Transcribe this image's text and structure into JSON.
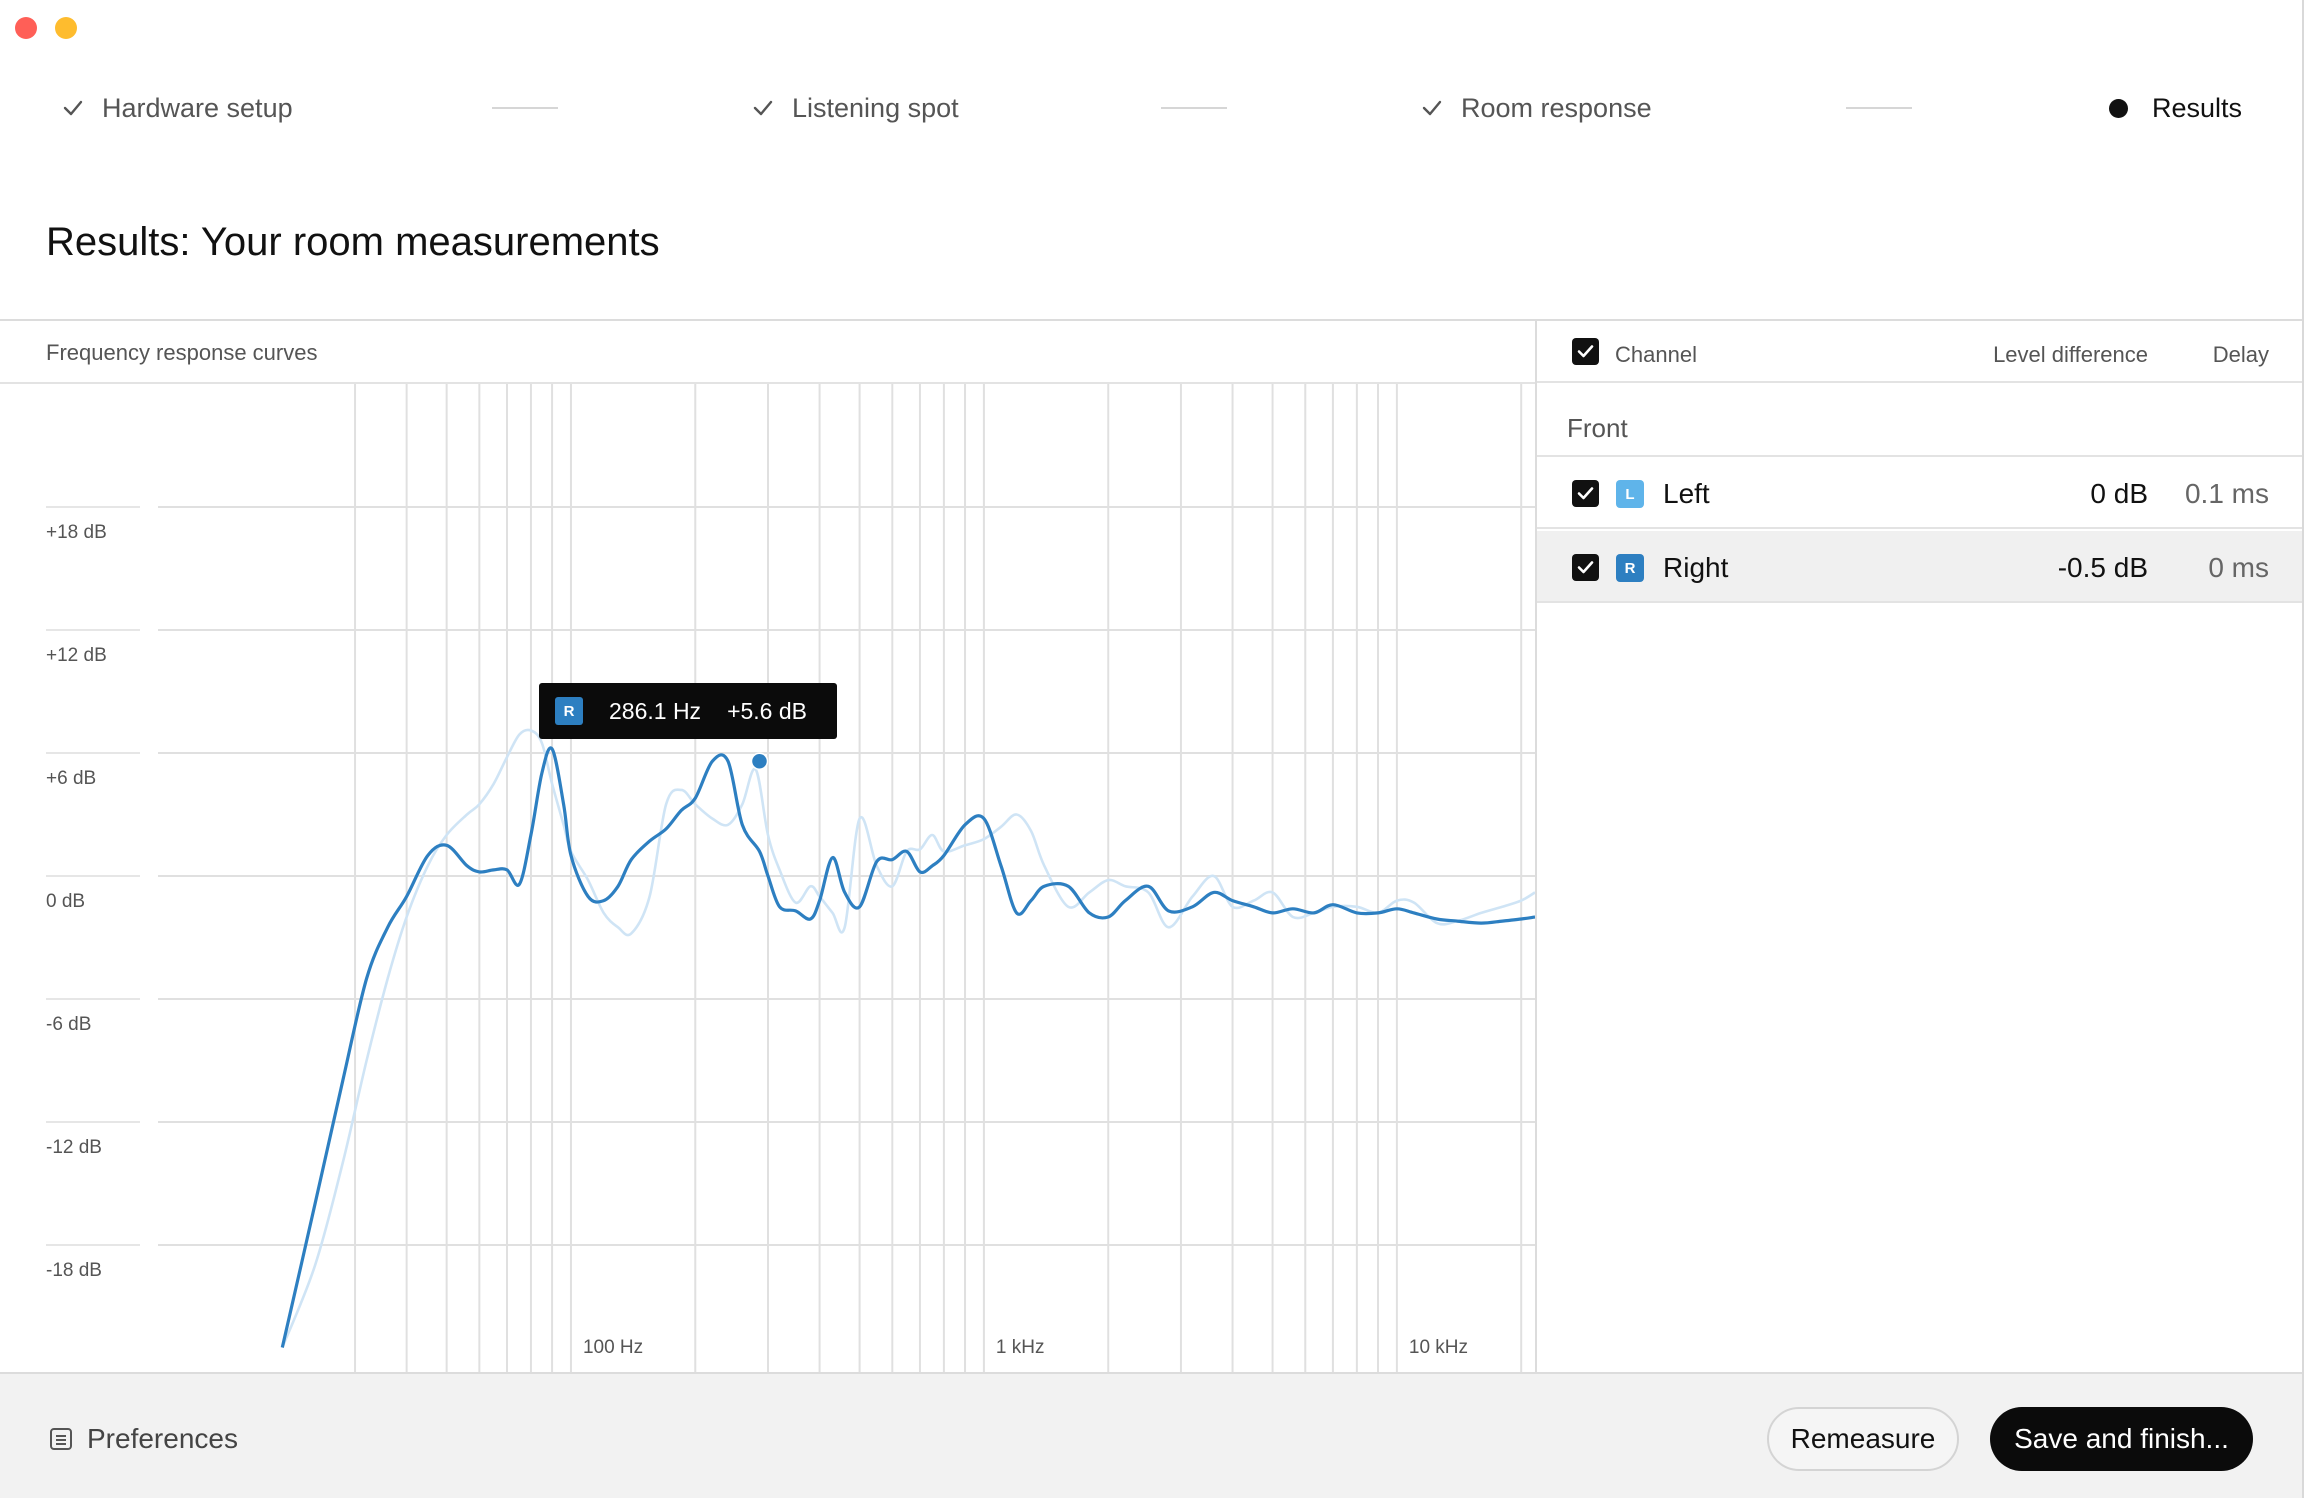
{
  "window": {
    "traffic_lights": [
      "close",
      "minimize"
    ]
  },
  "stepper": {
    "steps": [
      {
        "label": "Hardware setup",
        "state": "done",
        "icon": "check-icon"
      },
      {
        "label": "Listening spot",
        "state": "done",
        "icon": "check-icon"
      },
      {
        "label": "Room response",
        "state": "done",
        "icon": "check-icon"
      },
      {
        "label": "Results",
        "state": "current",
        "icon": "dot-icon"
      }
    ]
  },
  "page": {
    "title": "Results: Your room measurements"
  },
  "chart_panel": {
    "label": "Frequency response curves"
  },
  "tooltip": {
    "channel_badge": "R",
    "frequency": "286.1 Hz",
    "level": "+5.6 dB"
  },
  "table": {
    "header": {
      "channel": "Channel",
      "level_difference": "Level difference",
      "delay": "Delay"
    },
    "group": "Front",
    "rows": [
      {
        "badge": "L",
        "name": "Left",
        "level": "0 dB",
        "delay": "0.1 ms",
        "checked": true,
        "color": "#5fb4ea"
      },
      {
        "badge": "R",
        "name": "Right",
        "level": "-0.5 dB",
        "delay": "0 ms",
        "checked": true,
        "color": "#2d7fc1",
        "selected": true
      }
    ]
  },
  "footer": {
    "preferences_label": "Preferences",
    "remeasure_label": "Remeasure",
    "save_label": "Save and finish..."
  },
  "chart_data": {
    "type": "line",
    "title": "Frequency response curves",
    "xlabel": "",
    "ylabel": "",
    "x_scale": "log",
    "xlim": [
      10,
      21600
    ],
    "ylim": [
      -23,
      21
    ],
    "x_ticks": [
      {
        "value": 100,
        "label": "100 Hz"
      },
      {
        "value": 1000,
        "label": "1 kHz"
      },
      {
        "value": 10000,
        "label": "10 kHz"
      }
    ],
    "y_ticks": [
      {
        "value": 18,
        "label": "+18 dB"
      },
      {
        "value": 12,
        "label": "+12 dB"
      },
      {
        "value": 6,
        "label": "+6 dB"
      },
      {
        "value": 0,
        "label": "0 dB"
      },
      {
        "value": -6,
        "label": "-6 dB"
      },
      {
        "value": -12,
        "label": "-12 dB"
      },
      {
        "value": -18,
        "label": "-18 dB"
      }
    ],
    "grid": true,
    "highlight_point": {
      "series": "Right",
      "x": 286.1,
      "y": 5.6
    },
    "series": [
      {
        "name": "Left",
        "color": "#cfe4f5",
        "x": [
          20,
          24,
          28,
          32,
          36,
          40,
          45,
          50,
          56,
          60,
          65,
          70,
          75,
          80,
          85,
          90,
          96,
          100,
          110,
          120,
          130,
          140,
          155,
          170,
          185,
          200,
          220,
          240,
          260,
          280,
          300,
          320,
          350,
          380,
          400,
          430,
          460,
          500,
          550,
          600,
          650,
          700,
          750,
          800,
          900,
          1000,
          1100,
          1200,
          1300,
          1400,
          1600,
          1800,
          2000,
          2200,
          2500,
          2800,
          3200,
          3600,
          4000,
          4500,
          5000,
          5600,
          6300,
          7000,
          8000,
          9000,
          10000,
          11000,
          12500,
          14000,
          16000,
          18000,
          20000,
          21600
        ],
        "y": [
          -23,
          -19,
          -14,
          -9,
          -5,
          -2,
          0.5,
          2,
          3,
          3.5,
          4.5,
          5.8,
          6.9,
          7.1,
          6.5,
          4.5,
          2.5,
          1.2,
          -0.2,
          -1.8,
          -2.5,
          -2.8,
          -1,
          3.5,
          4.2,
          3.5,
          2.8,
          2.5,
          3.5,
          5.2,
          2,
          0.3,
          -1.3,
          -0.5,
          -1,
          -1.8,
          -2.5,
          2.8,
          0.5,
          -0.5,
          1.2,
          1.3,
          2,
          1.2,
          1.5,
          1.8,
          2.4,
          3,
          2.2,
          0.5,
          -1.5,
          -0.8,
          -0.2,
          -0.5,
          -0.8,
          -2.5,
          -1,
          0,
          -1.5,
          -1.2,
          -0.8,
          -2,
          -1.8,
          -1.5,
          -1.5,
          -1.8,
          -1.2,
          -1.3,
          -2.3,
          -2.2,
          -1.8,
          -1.5,
          -1.2,
          -0.8
        ]
      },
      {
        "name": "Right",
        "color": "#2d7fc1",
        "x": [
          20,
          24,
          28,
          32,
          36,
          40,
          45,
          50,
          56,
          60,
          65,
          70,
          75,
          80,
          85,
          90,
          96,
          100,
          110,
          120,
          130,
          140,
          155,
          170,
          185,
          200,
          220,
          240,
          260,
          286.1,
          300,
          320,
          350,
          380,
          400,
          430,
          460,
          500,
          550,
          600,
          650,
          700,
          750,
          800,
          900,
          1000,
          1100,
          1200,
          1300,
          1400,
          1600,
          1800,
          2000,
          2200,
          2500,
          2800,
          3200,
          3600,
          4000,
          4500,
          5000,
          5600,
          6300,
          7000,
          8000,
          9000,
          10000,
          11000,
          12500,
          14000,
          16000,
          18000,
          20000,
          21600
        ],
        "y": [
          -23,
          -16,
          -10,
          -5,
          -2.5,
          -1,
          1,
          1.5,
          0.5,
          0.2,
          0.3,
          0.3,
          -0.4,
          2,
          5,
          6.2,
          3.5,
          1,
          -1,
          -1.2,
          -0.5,
          0.8,
          1.7,
          2.3,
          3.2,
          3.8,
          5.6,
          5.6,
          2.5,
          1.2,
          0,
          -1.5,
          -1.7,
          -2.1,
          -1.2,
          0.9,
          -0.8,
          -1.5,
          0.7,
          0.8,
          1.2,
          0.2,
          0.5,
          1,
          2.5,
          2.8,
          0.5,
          -1.8,
          -1.2,
          -0.5,
          -0.5,
          -1.8,
          -2,
          -1.2,
          -0.5,
          -1.7,
          -1.5,
          -0.8,
          -1.2,
          -1.5,
          -1.8,
          -1.6,
          -1.8,
          -1.4,
          -1.8,
          -1.8,
          -1.6,
          -1.8,
          -2.1,
          -2.2,
          -2.3,
          -2.2,
          -2.1,
          -2
        ]
      }
    ]
  }
}
